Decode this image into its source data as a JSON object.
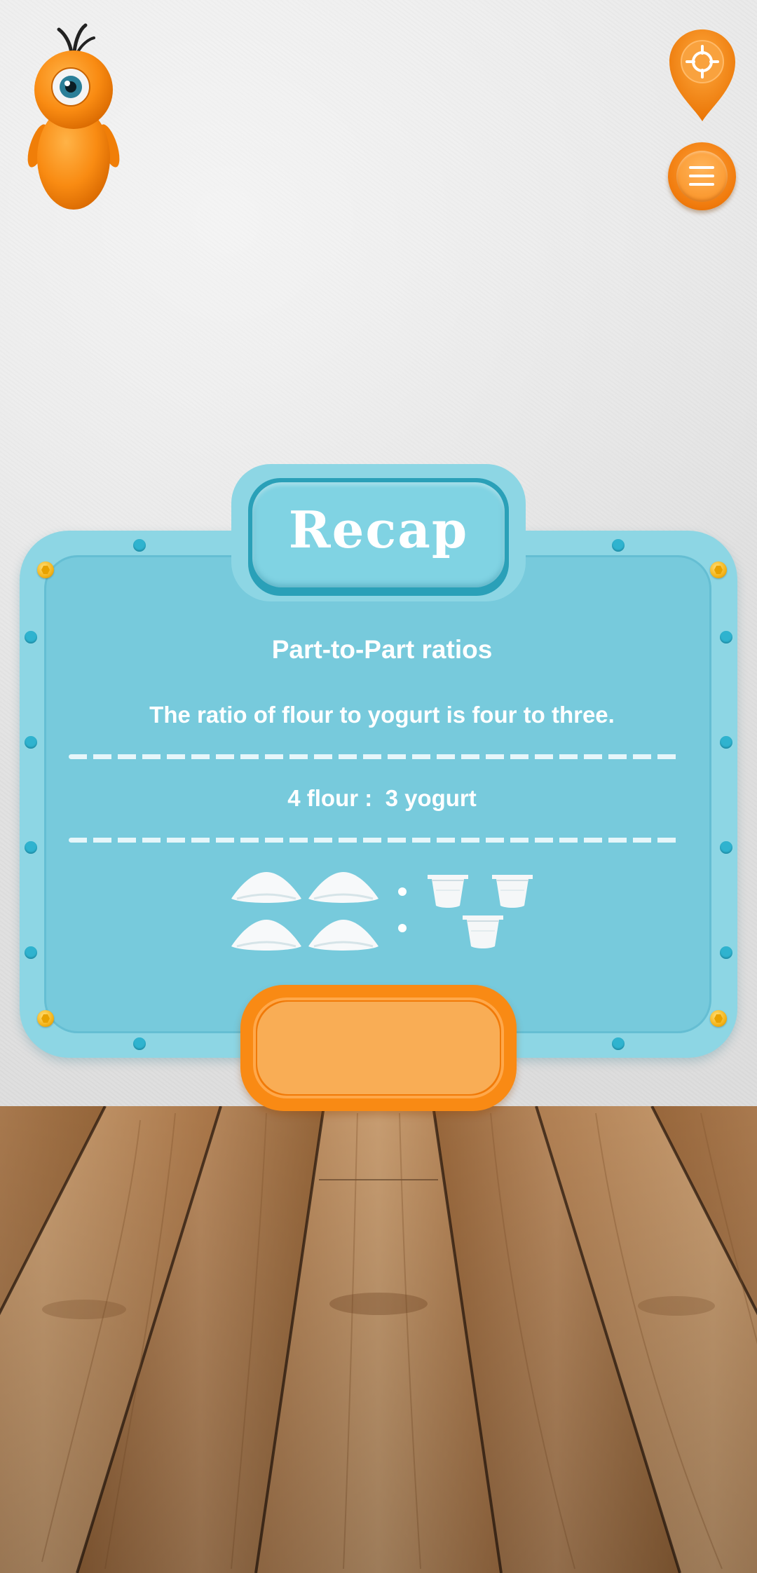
{
  "recap": {
    "title": "Recap",
    "subtitle": "Part-to-Part ratios",
    "sentence": "The ratio of flour to yogurt is four to three.",
    "ratio_text": "4 flour :  3 yogurt"
  },
  "ratio_visual": {
    "flour_count": 4,
    "yogurt_count": 3
  },
  "icons": {
    "mascot": "orange-one-eyed-mascot-icon",
    "locate": "location-pin-crosshair-icon",
    "menu": "hamburger-menu-icon",
    "flour": "flour-pile-icon",
    "yogurt": "yogurt-cup-icon"
  },
  "colors": {
    "accent_orange": "#f98a14",
    "board_blue": "#77cadc",
    "board_rim": "#8dd6e4",
    "text": "#ffffff"
  }
}
